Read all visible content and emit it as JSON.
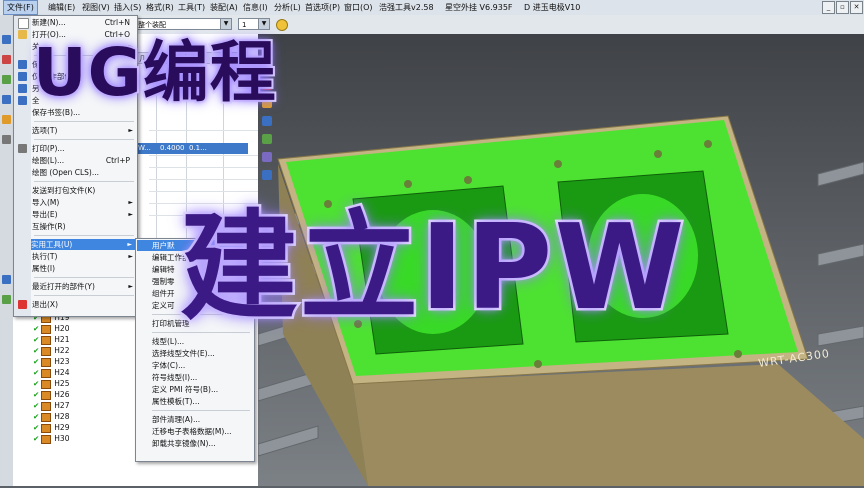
{
  "menubar": {
    "items": [
      "文件(F)",
      "编辑(E)",
      "视图(V)",
      "插入(S)",
      "格式(R)",
      "工具(T)",
      "装配(A)",
      "信息(I)",
      "分析(L)",
      "首选项(P)",
      "窗口(O)",
      "浩强工具v2.58",
      "星空外挂 V6.935F",
      "D 进玉电极V10"
    ],
    "active_index": 0
  },
  "toolbar": {
    "filter_combo": "整个装配",
    "count_combo": "1"
  },
  "navigator": {
    "col_header_1": "几...",
    "col_header_2": "余量",
    "selected_row": {
      "col1": "W...",
      "col2": "0.4000",
      "col3": "0.1..."
    },
    "tree_items": [
      "H19",
      "H20",
      "H21",
      "H22",
      "H23",
      "H24",
      "H25",
      "H26",
      "H27",
      "H28",
      "H29",
      "H30"
    ]
  },
  "file_menu": {
    "items": [
      {
        "label": "新建(N)...",
        "shortcut": "Ctrl+N"
      },
      {
        "label": "打开(O)...",
        "shortcut": "Ctrl+O"
      },
      {
        "label": "关",
        "shortcut": ""
      },
      {
        "label": "保",
        "shortcut": ""
      },
      {
        "label": "仅 工作部件",
        "shortcut": ""
      },
      {
        "label": "另 ...",
        "shortcut": ""
      },
      {
        "label": "全 ",
        "shortcut": ""
      },
      {
        "label": "保存书签(B)...",
        "shortcut": ""
      },
      {
        "label": "选项(T)",
        "shortcut": ""
      },
      {
        "label": "打印(P)...",
        "shortcut": ""
      },
      {
        "label": "绘图(L)...",
        "shortcut": "Ctrl+P"
      },
      {
        "label": "绘图 (Open CLS)...",
        "shortcut": ""
      },
      {
        "label": "发送到打包文件(K)",
        "shortcut": ""
      },
      {
        "label": "导入(M)",
        "shortcut": ""
      },
      {
        "label": "导出(E)",
        "shortcut": ""
      },
      {
        "label": "互操作(R)",
        "shortcut": ""
      },
      {
        "label": "实用工具(U)",
        "shortcut": ""
      },
      {
        "label": "执行(T)",
        "shortcut": ""
      },
      {
        "label": "属性(I)",
        "shortcut": ""
      },
      {
        "label": "最近打开的部件(Y)",
        "shortcut": ""
      },
      {
        "label": "退出(X)",
        "shortcut": ""
      }
    ]
  },
  "utilities_submenu": {
    "items": [
      "用户默",
      "编辑工作部",
      "编辑特",
      "强制零",
      "组件开",
      "定义可",
      "打印机管理",
      "线型(L)...",
      "选择线型文件(E)...",
      "字体(C)...",
      "符号线型(I)...",
      "定义 PMI 符号(B)...",
      "属性模板(T)...",
      "部件清理(A)...",
      "迁移电子表格数据(M)...",
      "卸载共享镜像(N)..."
    ]
  },
  "overlay": {
    "title_top": "UG编程",
    "title_main": "建立IPW"
  },
  "viewport": {
    "model_label": "WRT-AC300",
    "colors": {
      "toolpath": "#2cf01a",
      "block": "#a9986c",
      "block_top": "#c4b383",
      "rail": "#8e949a"
    }
  }
}
